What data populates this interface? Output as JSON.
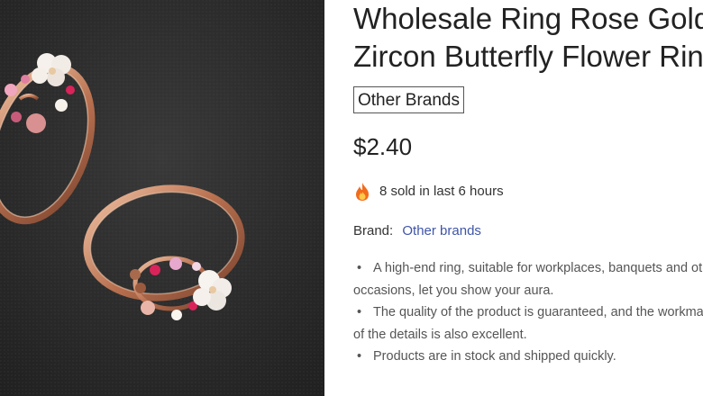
{
  "product": {
    "title_line1": "Wholesale Ring Rose Gold",
    "title_line2": "Zircon Butterfly Flower Ring",
    "brand_badge": "Other Brands",
    "price": "$2.40",
    "sold_text": "8 sold in last 6 hours",
    "brand_label": "Brand:",
    "brand_value": "Other brands",
    "bullets": [
      {
        "line1": "A high-end ring, suitable for workplaces, banquets and other",
        "line2": "occasions, let you show your aura."
      },
      {
        "line1": "The quality of the product is guaranteed, and the workmanship",
        "line2": "of the details is also excellent."
      },
      {
        "line1": "Products are in stock and shipped quickly.",
        "line2": ""
      }
    ]
  },
  "icons": {
    "sold": "fire-icon"
  },
  "colors": {
    "brand_link": "#3f55a8",
    "photo_background": "#2b2b2b",
    "ring_metal": "#c98a6a"
  }
}
